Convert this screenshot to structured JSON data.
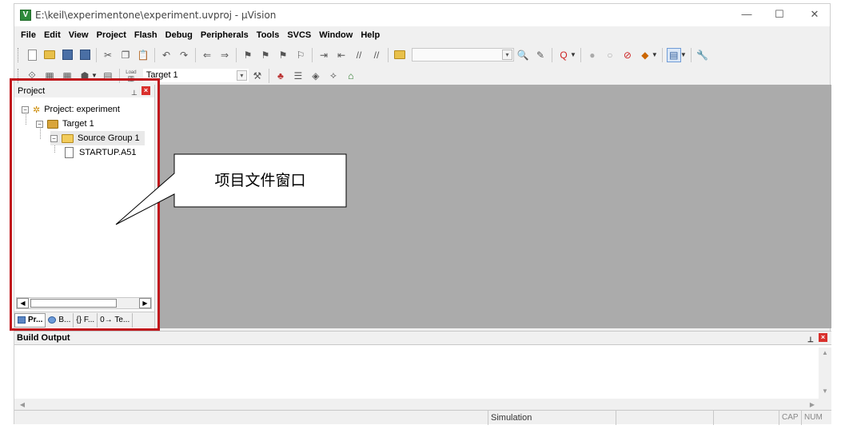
{
  "window": {
    "title": "E:\\keil\\experimentone\\experiment.uvproj - µVision",
    "app_icon_letter": "V",
    "minimize_glyph": "—",
    "maximize_glyph": "☐",
    "close_glyph": "✕"
  },
  "menu": [
    "File",
    "Edit",
    "View",
    "Project",
    "Flash",
    "Debug",
    "Peripherals",
    "Tools",
    "SVCS",
    "Window",
    "Help"
  ],
  "toolbar": {
    "target_combo_value": "Target 1",
    "load_label": "Load"
  },
  "project_panel": {
    "title": "Project",
    "tree": {
      "project": "Project: experiment",
      "target": "Target 1",
      "group": "Source Group 1",
      "file": "STARTUP.A51"
    },
    "tabs": [
      "Pr...",
      "B...",
      "{} F...",
      "0→ Te..."
    ]
  },
  "callout": {
    "text": "项目文件窗口"
  },
  "build_output": {
    "title": "Build Output"
  },
  "status_bar": {
    "mode": "Simulation",
    "cap": "CAP",
    "num": "NUM"
  },
  "colors": {
    "highlight_border": "#c0161c",
    "workspace_bg": "#ababab",
    "close_button": "#d9302c"
  }
}
